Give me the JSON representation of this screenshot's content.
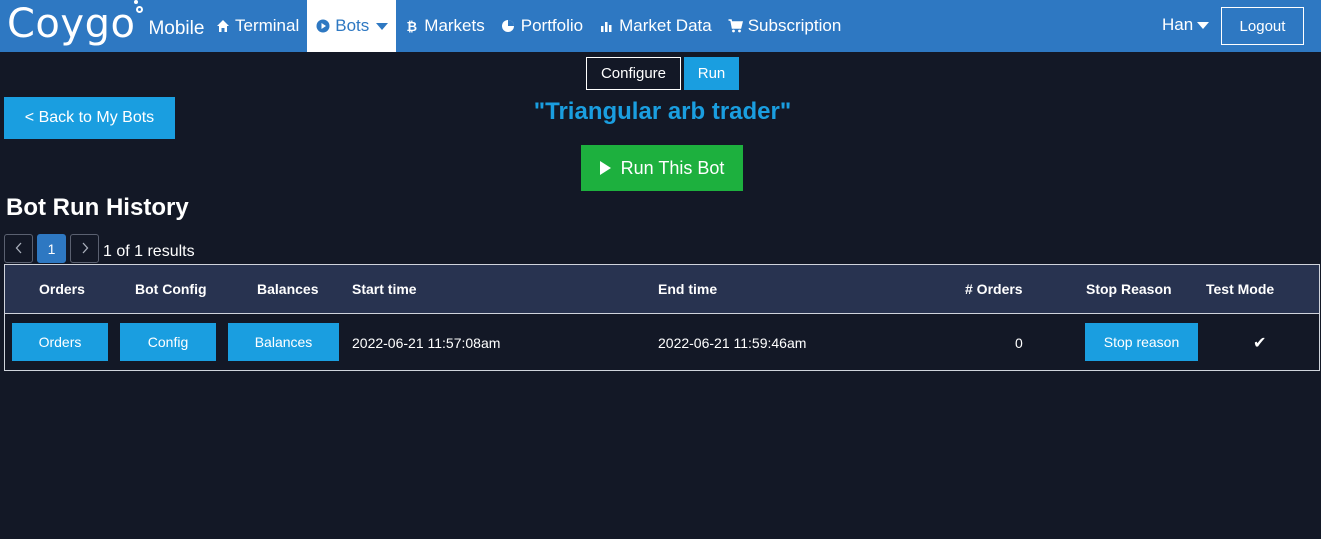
{
  "brand": {
    "logo": "Coygo",
    "sub": "Mobile"
  },
  "nav": {
    "items": [
      {
        "label": "Terminal",
        "icon": "home-icon"
      },
      {
        "label": "Bots",
        "icon": "bot-icon"
      },
      {
        "label": "Markets",
        "icon": "bitcoin-icon"
      },
      {
        "label": "Portfolio",
        "icon": "pie-chart-icon"
      },
      {
        "label": "Market Data",
        "icon": "bar-chart-icon"
      },
      {
        "label": "Subscription",
        "icon": "cart-icon"
      }
    ],
    "active": "Bots"
  },
  "user": {
    "name": "Han",
    "logout_label": "Logout"
  },
  "mode_tabs": {
    "configure": "Configure",
    "run": "Run",
    "active": "Run"
  },
  "back_label": "< Back to My Bots",
  "bot_title": "\"Triangular arb trader\"",
  "run_label": "Run This Bot",
  "history": {
    "title": "Bot Run History",
    "pagination": {
      "prev": "‹",
      "current": "1",
      "next": "›",
      "summary": "1 of 1 results"
    },
    "columns": {
      "orders": "Orders",
      "bot_config": "Bot Config",
      "balances": "Balances",
      "start_time": "Start time",
      "end_time": "End time",
      "num_orders": "# Orders",
      "stop_reason": "Stop Reason",
      "test_mode": "Test Mode"
    },
    "rows": [
      {
        "orders_btn": "Orders",
        "config_btn": "Config",
        "balances_btn": "Balances",
        "start_time": "2022-06-21 11:57:08am",
        "end_time": "2022-06-21 11:59:46am",
        "num_orders": "0",
        "stop_reason_btn": "Stop reason",
        "test_mode": "✔"
      }
    ]
  },
  "colors": {
    "nav_bg": "#2e78c2",
    "page_bg": "#131826",
    "accent": "#1a9ee0",
    "run_green": "#1db03e",
    "table_header": "#283350"
  }
}
